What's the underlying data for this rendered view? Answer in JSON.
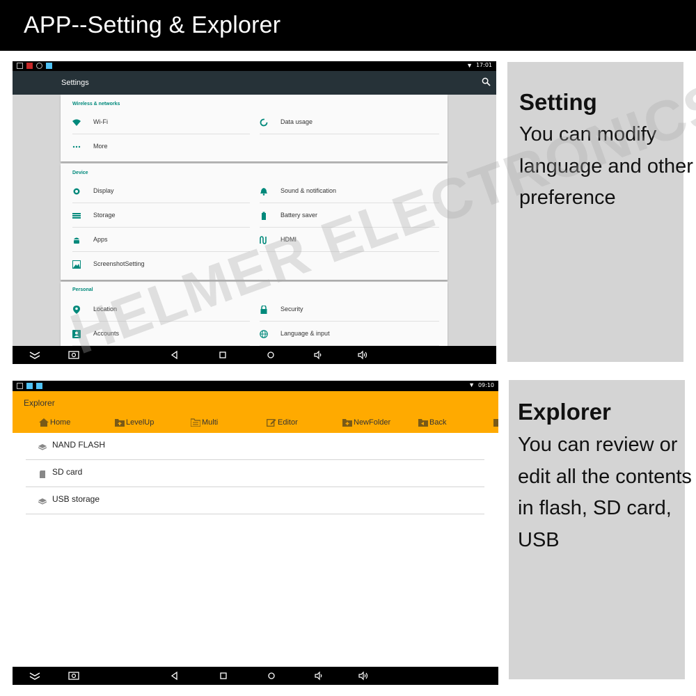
{
  "banner": {
    "title": "APP--Setting & Explorer"
  },
  "settings_screen": {
    "status_time": "17:01",
    "title": "Settings",
    "sections": [
      {
        "category": "Wireless & networks",
        "items": [
          {
            "label": "Wi-Fi",
            "icon": "wifi-icon"
          },
          {
            "label": "Data usage",
            "icon": "data-usage-icon"
          },
          {
            "label": "More",
            "icon": "more-icon"
          }
        ]
      },
      {
        "category": "Device",
        "items": [
          {
            "label": "Display",
            "icon": "display-icon"
          },
          {
            "label": "Sound & notification",
            "icon": "bell-icon"
          },
          {
            "label": "Storage",
            "icon": "storage-icon"
          },
          {
            "label": "Battery saver",
            "icon": "battery-icon"
          },
          {
            "label": "Apps",
            "icon": "android-icon"
          },
          {
            "label": "HDMI",
            "icon": "hdmi-icon"
          },
          {
            "label": "ScreenshotSetting",
            "icon": "image-icon"
          }
        ]
      },
      {
        "category": "Personal",
        "items": [
          {
            "label": "Location",
            "icon": "location-icon"
          },
          {
            "label": "Security",
            "icon": "lock-icon"
          },
          {
            "label": "Accounts",
            "icon": "account-icon"
          },
          {
            "label": "Language & input",
            "icon": "globe-icon"
          }
        ]
      }
    ]
  },
  "explorer_screen": {
    "status_time": "09:10",
    "title": "Explorer",
    "toolbar": [
      "Home",
      "LevelUp",
      "Multi",
      "Editor",
      "NewFolder",
      "Back"
    ],
    "files": [
      "NAND FLASH",
      "SD card",
      "USB storage"
    ]
  },
  "setting_panel": {
    "heading": "Setting",
    "body": "You can modify language and other preference"
  },
  "explorer_panel": {
    "heading": "Explorer",
    "body": "You can review or edit all the contents in flash, SD card, USB"
  },
  "watermark": "HELMER ELECTRONICS",
  "colors": {
    "settings_header": "#263238",
    "accent_teal": "#00897b",
    "explorer_header": "#ffaa00",
    "panel_bg": "#d4d4d4"
  }
}
